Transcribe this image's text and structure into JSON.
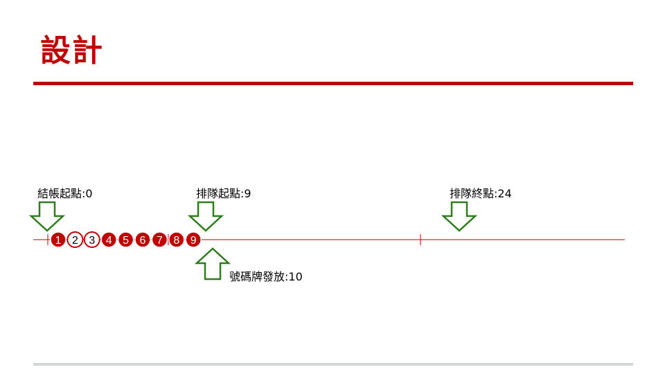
{
  "slide": {
    "title": "設計"
  },
  "timeline": {
    "line_color": "#c00000",
    "tokens": [
      {
        "label": "1",
        "style": "filled"
      },
      {
        "label": "2",
        "style": "outline"
      },
      {
        "label": "3",
        "style": "outline"
      },
      {
        "label": "4",
        "style": "filled"
      },
      {
        "label": "5",
        "style": "filled"
      },
      {
        "label": "6",
        "style": "filled"
      },
      {
        "label": "7",
        "style": "filled"
      },
      {
        "label": "8",
        "style": "filled"
      },
      {
        "label": "9",
        "style": "filled"
      }
    ],
    "markers": {
      "checkout_start": {
        "label": "結帳起點:0",
        "direction": "down"
      },
      "queue_start": {
        "label": "排隊起點:9",
        "direction": "down"
      },
      "queue_end": {
        "label": "排隊終點:24",
        "direction": "down"
      },
      "ticket_issue": {
        "label": "號碼牌發放:10",
        "direction": "up"
      }
    },
    "arrow_color": "#2e7d1c",
    "token_fill": "#c00000"
  }
}
